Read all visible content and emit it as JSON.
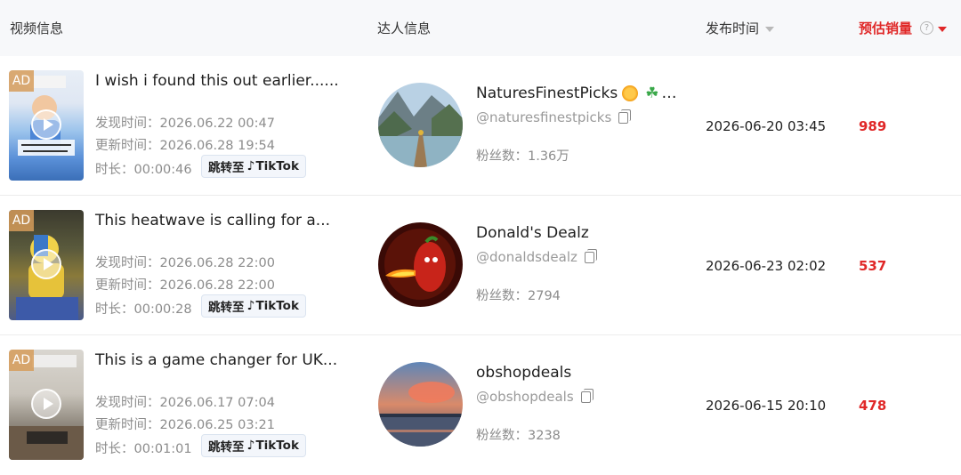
{
  "header": {
    "video_info": "视频信息",
    "creator_info": "达人信息",
    "publish_time": "发布时间",
    "est_sales": "预估销量",
    "help_symbol": "?"
  },
  "labels": {
    "ad": "AD",
    "jump": "跳转至",
    "tiktok": "TikTok",
    "tiktok_icon": "♪"
  },
  "rows": [
    {
      "title": "I wish i found this out earlier......",
      "discover": "发现时间：2026.06.22 00:47",
      "update": "更新时间：2026.06.28 19:54",
      "duration": "时长：00:00:46",
      "creator_name": "NaturesFinestPicks",
      "name_emojis": "…",
      "clover": "☘",
      "handle": "@naturesfinestpicks",
      "fans": "粉丝数：1.36万",
      "publish": "2026-06-20 03:45",
      "sales": "989"
    },
    {
      "title": "This heatwave is calling for a...",
      "discover": "发现时间：2026.06.28 22:00",
      "update": "更新时间：2026.06.28 22:00",
      "duration": "时长：00:00:28",
      "creator_name": "Donald's Dealz",
      "handle": "@donaldsdealz",
      "fans": "粉丝数：2794",
      "publish": "2026-06-23 02:02",
      "sales": "537"
    },
    {
      "title": "This is a game changer for UK...",
      "discover": "发现时间：2026.06.17 07:04",
      "update": "更新时间：2026.06.25 03:21",
      "duration": "时长：00:01:01",
      "creator_name": "obshopdeals",
      "handle": "@obshopdeals",
      "fans": "粉丝数：3238",
      "publish": "2026-06-15 20:10",
      "sales": "478"
    }
  ],
  "colors": {
    "accent_red": "#e02828",
    "header_bg": "#f7f8fa"
  }
}
